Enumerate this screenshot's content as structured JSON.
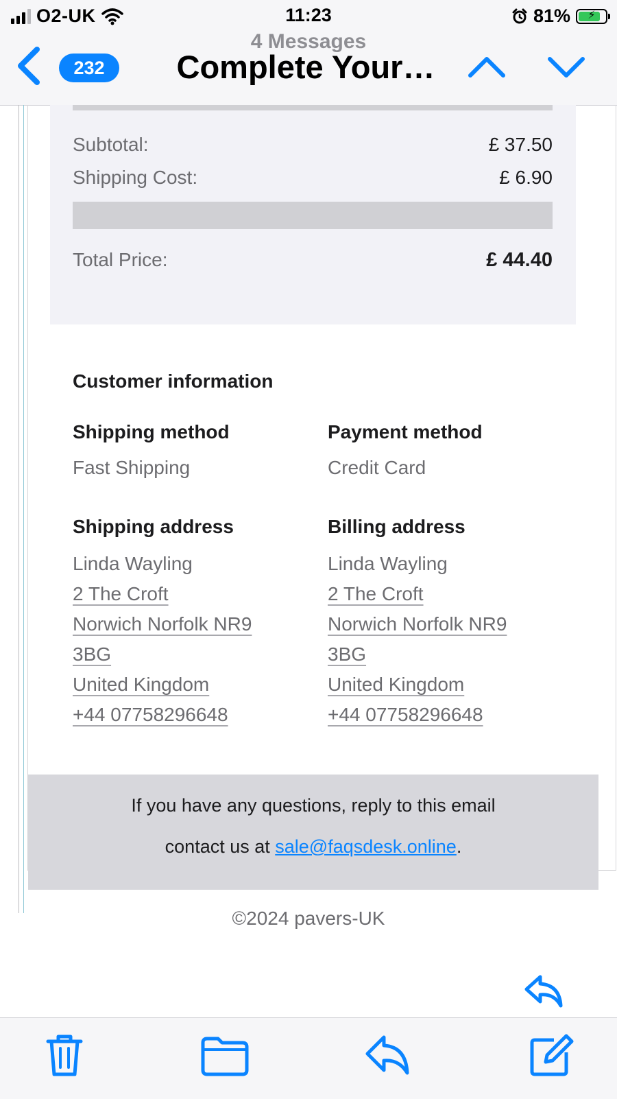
{
  "status_bar": {
    "carrier": "O2-UK",
    "time": "11:23",
    "battery_percent": "81%",
    "battery_level": 0.81,
    "charging": true,
    "icons": [
      "signal-icon",
      "wifi-icon",
      "alarm-icon",
      "battery-icon"
    ]
  },
  "nav": {
    "back_count": "232",
    "subtitle": "4 Messages",
    "title": "Complete Your…",
    "icons": [
      "back-chevron-icon",
      "chevron-up-icon",
      "chevron-down-icon"
    ]
  },
  "summary": {
    "subtotal_label": "Subtotal:",
    "subtotal_value": "£ 37.50",
    "shipping_label": "Shipping Cost:",
    "shipping_value": "£ 6.90",
    "total_label": "Total Price:",
    "total_value": "£ 44.40"
  },
  "customer": {
    "title": "Customer information",
    "shipping_method_heading": "Shipping method",
    "shipping_method_value": "Fast Shipping",
    "payment_method_heading": "Payment method",
    "payment_method_value": "Credit Card",
    "shipping_address_heading": "Shipping address",
    "shipping_address": {
      "name": "Linda Wayling",
      "street": "2 The Croft",
      "city_line": "Norwich Norfolk NR9",
      "postcode_tail": "3BG",
      "country": "United Kingdom",
      "phone": "+44 07758296648"
    },
    "billing_address_heading": "Billing address",
    "billing_address": {
      "name": "Linda Wayling",
      "street": "2 The Croft",
      "city_line": "Norwich Norfolk NR9",
      "postcode_tail": "3BG",
      "country": "United Kingdom",
      "phone": "+44 07758296648"
    }
  },
  "footer": {
    "line1": "If you have any questions, reply to this email",
    "line2_prefix": "contact us at ",
    "email_link": "sale@faqsdesk.online",
    "line2_suffix": ".",
    "copyright": "©2024 pavers-UK"
  },
  "toolbar": {
    "icons": [
      "trash-icon",
      "folder-icon",
      "reply-icon",
      "compose-icon"
    ]
  },
  "colors": {
    "accent": "#0a84ff",
    "battery_green": "#34c759",
    "summary_bg": "#f2f2f7",
    "footer_bg": "#d7d7dc"
  }
}
